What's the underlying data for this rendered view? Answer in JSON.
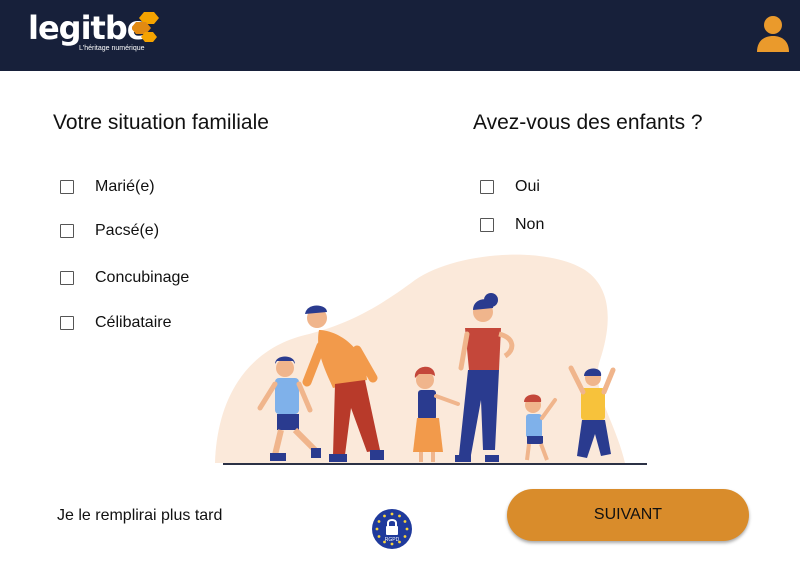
{
  "header": {
    "logo_text": "legitbe",
    "logo_tagline": "L'héritage numérique",
    "profile_icon": "user-icon"
  },
  "family_situation": {
    "title": "Votre situation familiale",
    "options": [
      {
        "label": "Marié(e)",
        "checked": false
      },
      {
        "label": "Pacsé(e)",
        "checked": false
      },
      {
        "label": "Concubinage",
        "checked": false
      },
      {
        "label": "Célibataire",
        "checked": false
      }
    ]
  },
  "children": {
    "title": "Avez-vous des enfants ?",
    "options": [
      {
        "label": "Oui",
        "checked": false
      },
      {
        "label": "Non",
        "checked": false
      }
    ]
  },
  "footer": {
    "later_link": "Je le remplirai plus tard",
    "rgpd_badge": "RGPD",
    "next_button": "SUIVANT"
  },
  "colors": {
    "header_bg": "#17203a",
    "accent_orange": "#d98c2b",
    "blob_bg": "#fbe9da"
  }
}
